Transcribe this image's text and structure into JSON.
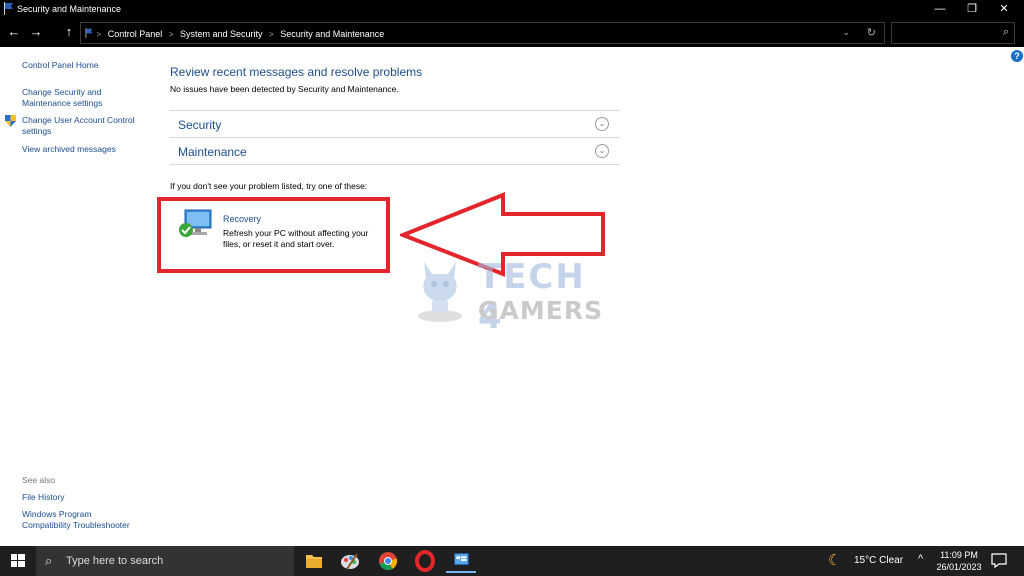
{
  "window": {
    "title": "Security and Maintenance",
    "controls": {
      "minimize": "—",
      "restore": "❐",
      "close": "✕"
    }
  },
  "addressbar": {
    "back": "←",
    "forward": "→",
    "up": "↑",
    "breadcrumbs": [
      "Control Panel",
      "System and Security",
      "Security and Maintenance"
    ],
    "separator": ">",
    "dropdown_icon": "⌄",
    "refresh_icon": "↻",
    "search_placeholder": "",
    "search_icon": "⌕"
  },
  "sidebar": {
    "home": "Control Panel Home",
    "links": [
      {
        "label": "Change Security and\nMaintenance settings"
      },
      {
        "label": "Change User Account Control\nsettings",
        "icon": "shield-icon"
      },
      {
        "label": "View archived messages"
      }
    ],
    "see_also_label": "See also",
    "see_also": [
      {
        "label": "File History"
      },
      {
        "label": "Windows Program\nCompatibility Troubleshooter"
      }
    ]
  },
  "help_icon": "?",
  "main": {
    "heading": "Review recent messages and resolve problems",
    "status": "No issues have been detected by Security and Maintenance.",
    "sections": [
      {
        "label": "Security",
        "chevron": "⌄"
      },
      {
        "label": "Maintenance",
        "chevron": "⌄"
      }
    ],
    "try_line": "If you don't see your problem listed, try one of these:",
    "recovery": {
      "title": "Recovery",
      "description": "Refresh your PC without affecting your files, or reset it and start over."
    }
  },
  "annotation": {
    "color": "#e3262b"
  },
  "watermark": {
    "line1": "TECH 4",
    "line2": "GAMERS"
  },
  "taskbar": {
    "search_placeholder": "Type here to search",
    "search_icon": "⌕",
    "apps": [
      "file-explorer-icon",
      "paint-icon",
      "chrome-icon",
      "opera-icon",
      "control-panel-icon"
    ],
    "weather": {
      "temp": "15°C Clear",
      "icon": "☾"
    },
    "tray_caret": "^",
    "time": "11:09 PM",
    "date": "26/01/2023"
  },
  "colors": {
    "accent": "#1e4e8c",
    "link": "#1a4d8f",
    "highlight": "#e3262b"
  }
}
